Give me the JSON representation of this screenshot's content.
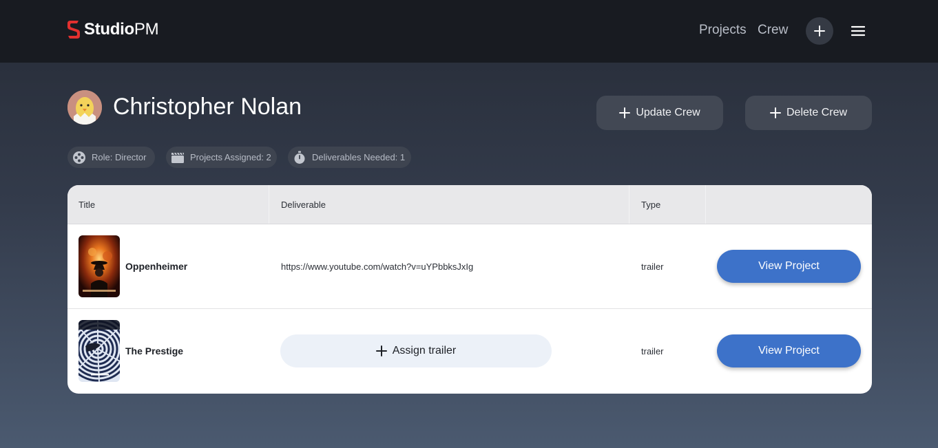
{
  "brand": {
    "name_bold": "Studio",
    "name_light": "PM",
    "accent": "#e2302f"
  },
  "nav": {
    "links": [
      "Projects",
      "Crew"
    ],
    "plus_icon": "plus-icon",
    "menu_icon": "hamburger-menu-icon"
  },
  "crew": {
    "name": "Christopher Nolan",
    "update_label": "Update Crew",
    "delete_label": "Delete Crew",
    "chips": {
      "role": "Role: Director",
      "projects": "Projects Assigned: 2",
      "deliverables": "Deliverables Needed: 1"
    }
  },
  "table": {
    "headers": {
      "title": "Title",
      "deliverable": "Deliverable",
      "type": "Type"
    },
    "rows": [
      {
        "title": "Oppenheimer",
        "deliverable": "https://www.youtube.com/watch?v=uYPbbksJxIg",
        "type": "trailer",
        "action": "View Project"
      },
      {
        "title": "The Prestige",
        "deliverable_action": "Assign trailer",
        "type": "trailer",
        "action": "View Project"
      }
    ]
  },
  "colors": {
    "navbar": "#181b21",
    "primary_button": "#3d72c9",
    "secondary_button": "#424854",
    "chip": "#3e4450"
  }
}
